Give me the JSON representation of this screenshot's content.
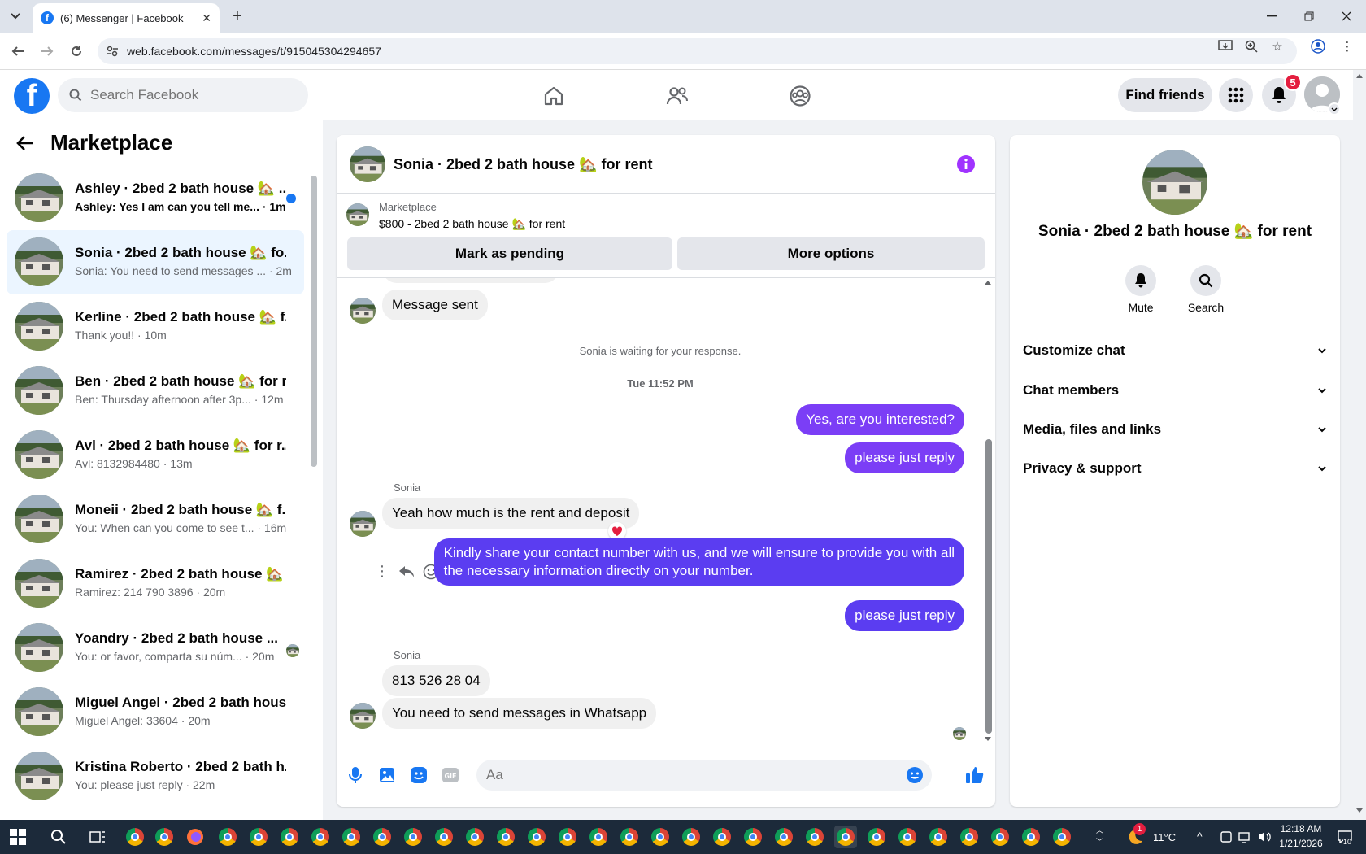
{
  "browser": {
    "tab_title": "(6) Messenger | Facebook",
    "url": "web.facebook.com/messages/t/915045304294657"
  },
  "fb": {
    "search_placeholder": "Search Facebook",
    "find_friends": "Find friends",
    "notifications_count": "5"
  },
  "left": {
    "title": "Marketplace",
    "chats": [
      {
        "name": "Ashley · 2bed 2 bath house 🏡 ...",
        "preview": "Ashley: Yes I am can you tell me... · 1m"
      },
      {
        "name": "Sonia · 2bed 2 bath house 🏡 fo...",
        "preview": "Sonia: You need to send messages ... · 2m"
      },
      {
        "name": "Kerline · 2bed 2 bath house 🏡 f...",
        "preview": "Thank you!! · 10m"
      },
      {
        "name": "Ben · 2bed 2 bath house 🏡 for r...",
        "preview": "Ben: Thursday afternoon after 3p... · 12m"
      },
      {
        "name": "Avl · 2bed 2 bath house 🏡 for r...",
        "preview": "Avl: 8132984480 · 13m"
      },
      {
        "name": "Moneii · 2bed 2 bath house 🏡 f...",
        "preview": "You: When can you come to see t... · 16m"
      },
      {
        "name": "Ramirez · 2bed 2 bath house 🏡 ...",
        "preview": "Ramirez: 214 790 3896 · 20m"
      },
      {
        "name": "Yoandry · 2bed 2 bath house ...",
        "preview": "You: or favor, comparta su núm... · 20m"
      },
      {
        "name": "Miguel Angel · 2bed 2 bath hous...",
        "preview": "Miguel Angel: 33604 · 20m"
      },
      {
        "name": "Kristina Roberto · 2bed 2 bath h...",
        "preview": "You: please just reply · 22m"
      }
    ]
  },
  "chat": {
    "title": "Sonia · 2bed 2 bath house 🏡 for rent",
    "marketplace_label": "Marketplace",
    "listing": "$800 - 2bed 2 bath house 🏡 for rent",
    "mark_pending": "Mark as pending",
    "more_options": "More options",
    "messages": {
      "m1": "Message sent",
      "waiting": "Sonia is waiting for your response.",
      "timestamp": "Tue 11:52 PM",
      "m2": "Yes, are you interested?",
      "m3": "please just reply",
      "sender1": "Sonia",
      "m4": "Yeah how much is the rent and deposit",
      "m5_line1": "Kindly share your contact number with us, and we will ensure to provide you with all",
      "m5_line2": "the necessary information directly on your number.",
      "m6": "please just reply",
      "sender2": "Sonia",
      "m7": "813 526 28 04",
      "m8": "You need to send messages in Whatsapp"
    },
    "composer_placeholder": "Aa"
  },
  "right": {
    "title": "Sonia · 2bed 2 bath house 🏡 for rent",
    "mute": "Mute",
    "search": "Search",
    "sections": [
      "Customize chat",
      "Chat members",
      "Media, files and links",
      "Privacy & support"
    ]
  },
  "taskbar": {
    "temperature": "11°C",
    "time": "12:18 AM",
    "date": "1/21/2026",
    "weather_badge": "1",
    "notif_count": "10"
  },
  "colors": {
    "fb_blue": "#1877f2",
    "bubble_out": "#7b3ef6",
    "bubble_out_alt": "#5b3df1",
    "info_purple": "#a033ff"
  }
}
